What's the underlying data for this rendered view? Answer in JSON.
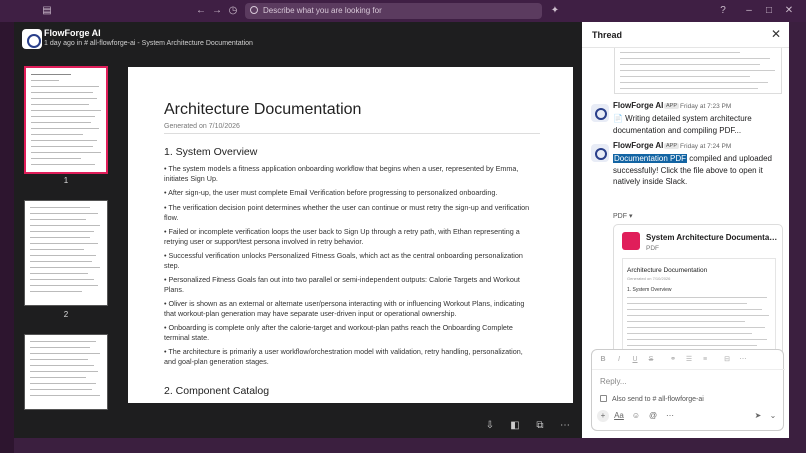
{
  "topbar": {
    "search_placeholder": "Describe what you are looking for"
  },
  "viewer": {
    "title": "FlowForge AI",
    "subtitle": "1 day ago in # all-flowforge-ai  - System Architecture Documentation",
    "thumb_labels": [
      "1",
      "2"
    ],
    "doc": {
      "title": "Architecture Documentation",
      "generated": "Generated on 7/10/2026",
      "section1": "1. System Overview",
      "paras": [
        "• The system models a fitness application onboarding workflow that begins when a user, represented by Emma, initiates Sign Up.",
        "• After sign-up, the user must complete Email Verification before progressing to personalized onboarding.",
        "• The verification decision point determines whether the user can continue or must retry the sign-up and verification flow.",
        "• Failed or incomplete verification loops the user back to Sign Up through a retry path, with Ethan representing a retrying user or support/test persona involved in retry behavior.",
        "• Successful verification unlocks Personalized Fitness Goals, which act as the central onboarding personalization step.",
        "• Personalized Fitness Goals fan out into two parallel or semi-independent outputs: Calorie Targets and Workout Plans.",
        "• Oliver is shown as an external or alternate user/persona interacting with or influencing Workout Plans, indicating that workout-plan generation may have separate user-driven input or operational ownership.",
        "• Onboarding is complete only after the calorie-target and workout-plan paths reach the Onboarding Complete terminal state.",
        "• The architecture is primarily a user workflow/orchestration model with validation, retry handling, personalization, and goal-plan generation stages."
      ],
      "section2": "2. Component Catalog"
    }
  },
  "thread": {
    "title": "Thread",
    "messages": [
      {
        "author": "FlowForge AI",
        "badge": "APP",
        "time": "Friday at 7:23 PM",
        "text": "📄 Writing detailed system architecture documentation and compiling PDF..."
      },
      {
        "author": "FlowForge AI",
        "badge": "APP",
        "time": "Friday at 7:24 PM",
        "highlight": " Documentation PDF",
        "text": " compiled and uploaded successfully! Click the file above to open it natively inside Slack."
      }
    ],
    "pdf_label": "PDF ▾",
    "file": {
      "name": "System Architecture Documentation",
      "type": "PDF",
      "preview_title": "Architecture Documentation",
      "preview_gen": "Generated on 7/10/2026",
      "preview_section": "1. System Overview"
    },
    "composer": {
      "placeholder": "Reply...",
      "also_send": "Also send to # all-flowforge-ai"
    }
  }
}
